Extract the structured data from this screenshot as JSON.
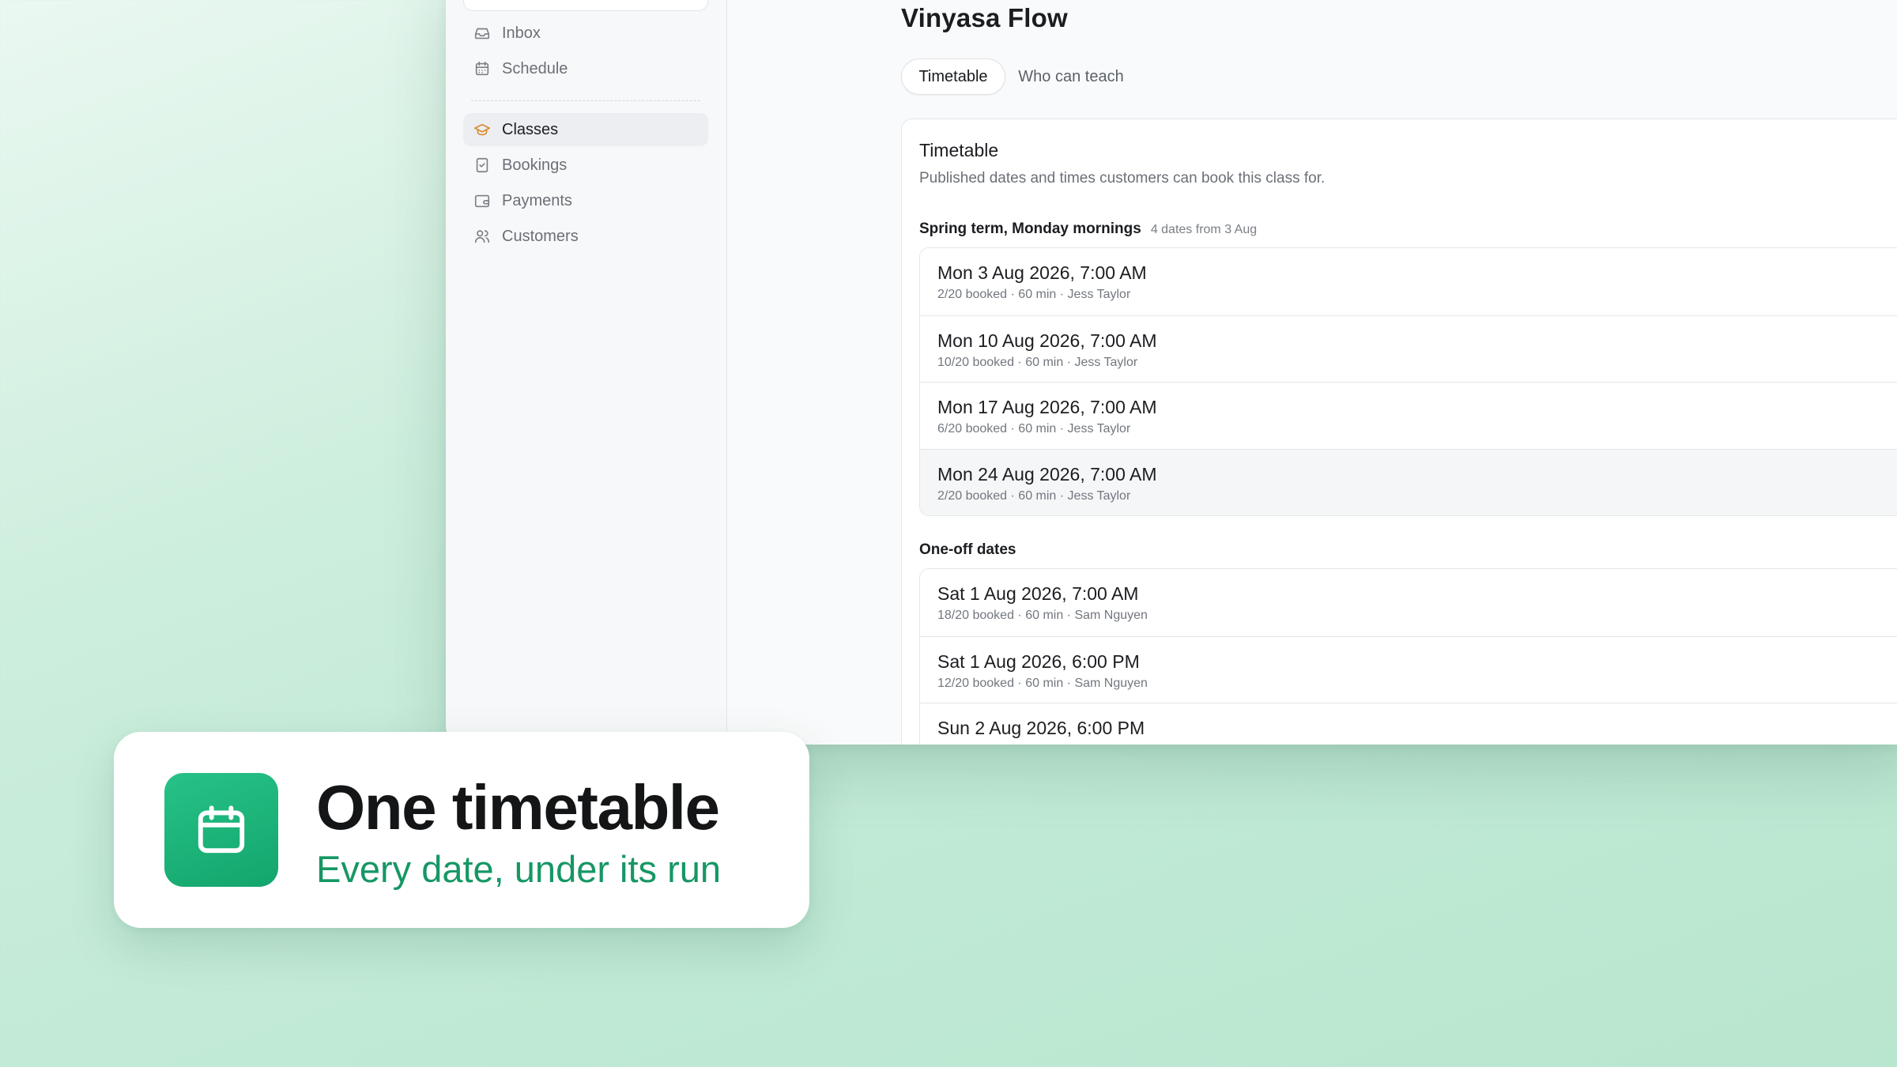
{
  "sidebar": {
    "items": [
      {
        "label": "Inbox",
        "icon": "inbox-icon"
      },
      {
        "label": "Schedule",
        "icon": "calendar-icon"
      },
      {
        "label": "Classes",
        "icon": "graduation-cap-icon",
        "active": true
      },
      {
        "label": "Bookings",
        "icon": "clipboard-check-icon"
      },
      {
        "label": "Payments",
        "icon": "wallet-icon"
      },
      {
        "label": "Customers",
        "icon": "users-icon"
      }
    ]
  },
  "page": {
    "title": "Vinyasa Flow",
    "tabs": [
      {
        "label": "Timetable",
        "active": true
      },
      {
        "label": "Who can teach"
      }
    ]
  },
  "timetable": {
    "title": "Timetable",
    "description": "Published dates and times customers can book this class for.",
    "groups": [
      {
        "title": "Spring term, Monday mornings",
        "meta": "4 dates from 3 Aug",
        "dates": [
          {
            "when": "Mon 3 Aug 2026, 7:00 AM",
            "sub": "2/20 booked · 60 min · Jess Taylor"
          },
          {
            "when": "Mon 10 Aug 2026, 7:00 AM",
            "sub": "10/20 booked · 60 min · Jess Taylor"
          },
          {
            "when": "Mon 17 Aug 2026, 7:00 AM",
            "sub": "6/20 booked · 60 min · Jess Taylor"
          },
          {
            "when": "Mon 24 Aug 2026, 7:00 AM",
            "sub": "2/20 booked · 60 min · Jess Taylor",
            "hover": true
          }
        ]
      },
      {
        "title": "One-off dates",
        "meta": "",
        "dates": [
          {
            "when": "Sat 1 Aug 2026, 7:00 AM",
            "sub": "18/20 booked · 60 min · Sam Nguyen"
          },
          {
            "when": "Sat 1 Aug 2026, 6:00 PM",
            "sub": "12/20 booked · 60 min · Sam Nguyen"
          },
          {
            "when": "Sun 2 Aug 2026, 6:00 PM",
            "sub": ""
          }
        ]
      }
    ]
  },
  "callout": {
    "icon": "calendar-icon",
    "title": "One timetable",
    "subtitle": "Every date, under its run"
  },
  "colors": {
    "accent": "#169764",
    "active_nav_icon": "#d98a2b"
  }
}
